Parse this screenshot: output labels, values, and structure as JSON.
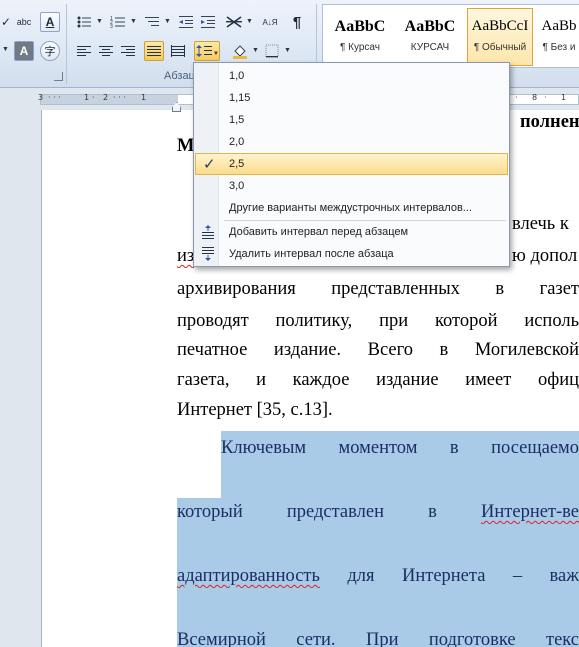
{
  "ribbon": {
    "paragraph_group_label": "Абзац",
    "style_tiles": [
      {
        "sample": "AaBbC",
        "name": "¶ Курсач"
      },
      {
        "sample": "AaBbC",
        "name": "КУРСАЧ"
      },
      {
        "sample": "AaBbCcI",
        "name": "¶ Обычный"
      },
      {
        "sample": "AaBb",
        "name": "¶ Без и"
      }
    ],
    "icons": {
      "sort": "А↓Я",
      "pilcrow": "¶",
      "text_color": "A",
      "abc": "abc"
    }
  },
  "ruler": {
    "numbers": [
      "3",
      "1",
      "2",
      "1",
      "8",
      "1"
    ]
  },
  "line_spacing_menu": {
    "options": [
      "1,0",
      "1,15",
      "1,5",
      "2,0",
      "2,5",
      "3,0"
    ],
    "selected": "2,5",
    "other_options": "Другие варианты междустрочных интервалов...",
    "add_before": "Добавить интервал перед абзацем",
    "remove_after": "Удалить интервал после абзаца"
  },
  "document": {
    "partial_heading_right": "полнен",
    "partial_heading_left": "М",
    "line1_right": "влечь к",
    "line2_left": "из",
    "line2_right": "ю допол",
    "line3": [
      "архивирования",
      "представленных",
      "в",
      "газет"
    ],
    "line4": [
      "проводят",
      "политику,",
      "при",
      "которой",
      "исполь"
    ],
    "line5": [
      "печатное",
      "издание.",
      "Всего",
      "в",
      "Могилевской"
    ],
    "line6": [
      "газета,",
      "и",
      "каждое",
      "издание",
      "имеет",
      "офиц"
    ],
    "line7": "Интернет [35, с.13].",
    "sel_line1": [
      "Ключевым",
      "моментом",
      "в",
      "посещаемо"
    ],
    "sel_line2": [
      "который",
      "представлен",
      "в",
      "Интернет-ве"
    ],
    "sel_line3": [
      "адаптированность",
      "для",
      "Интернета",
      "–",
      "важ"
    ],
    "sel_line4": [
      "Всемирной",
      "сети.",
      "При",
      "подготовке",
      "текс"
    ]
  }
}
